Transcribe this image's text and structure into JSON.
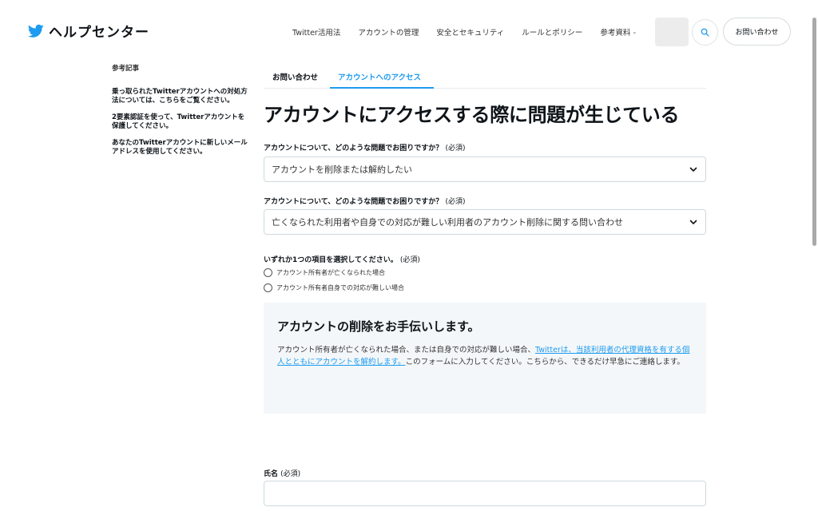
{
  "header": {
    "logo_text": "ヘルプセンター",
    "nav": [
      "Twitter活用法",
      "アカウントの管理",
      "安全とセキュリティ",
      "ルールとポリシー"
    ],
    "nav_last": "参考資料",
    "contact_button": "お問い合わせ"
  },
  "sidebar": {
    "title": "参考記事",
    "links": [
      "乗っ取られたTwitterアカウントへの対処方法については、こちらをご覧ください。",
      "2要素認証を使って、Twitterアカウントを保護してください。",
      "あなたのTwitterアカウントに新しいメールアドレスを使用してください。"
    ]
  },
  "tabs": [
    "お問い合わせ",
    "アカウントへのアクセス"
  ],
  "page_title": "アカウントにアクセスする際に問題が生じている",
  "form": {
    "q1_label": "アカウントについて、どのような問題でお困りですか？",
    "q1_required": "(必須)",
    "q1_value": "アカウントを削除または解約したい",
    "q2_label": "アカウントについて、どのような問題でお困りですか？",
    "q2_required": "(必須)",
    "q2_value": "亡くなられた利用者や自身での対応が難しい利用者のアカウント削除に関する問い合わせ",
    "radio_label": "いずれか1つの項目を選択してください。",
    "radio_required": "(必須)",
    "radio_options": [
      "アカウント所有者が亡くなられた場合",
      "アカウント所有者自身での対応が難しい場合"
    ],
    "name_label": "氏名",
    "name_required": "(必須)"
  },
  "info": {
    "title": "アカウントの削除をお手伝いします。",
    "text_before": "アカウント所有者が亡くなられた場合、または自身での対応が難しい場合、",
    "link_text": "Twitterは、当該利用者の代理資格を有する個人とともにアカウントを解約します。",
    "text_after": "このフォームに入力してください。こちらから、できるだけ早急にご連絡します。"
  },
  "colors": {
    "accent": "#1d9bf0",
    "info_bg": "#f4f7f9",
    "border": "#cfd9de"
  }
}
